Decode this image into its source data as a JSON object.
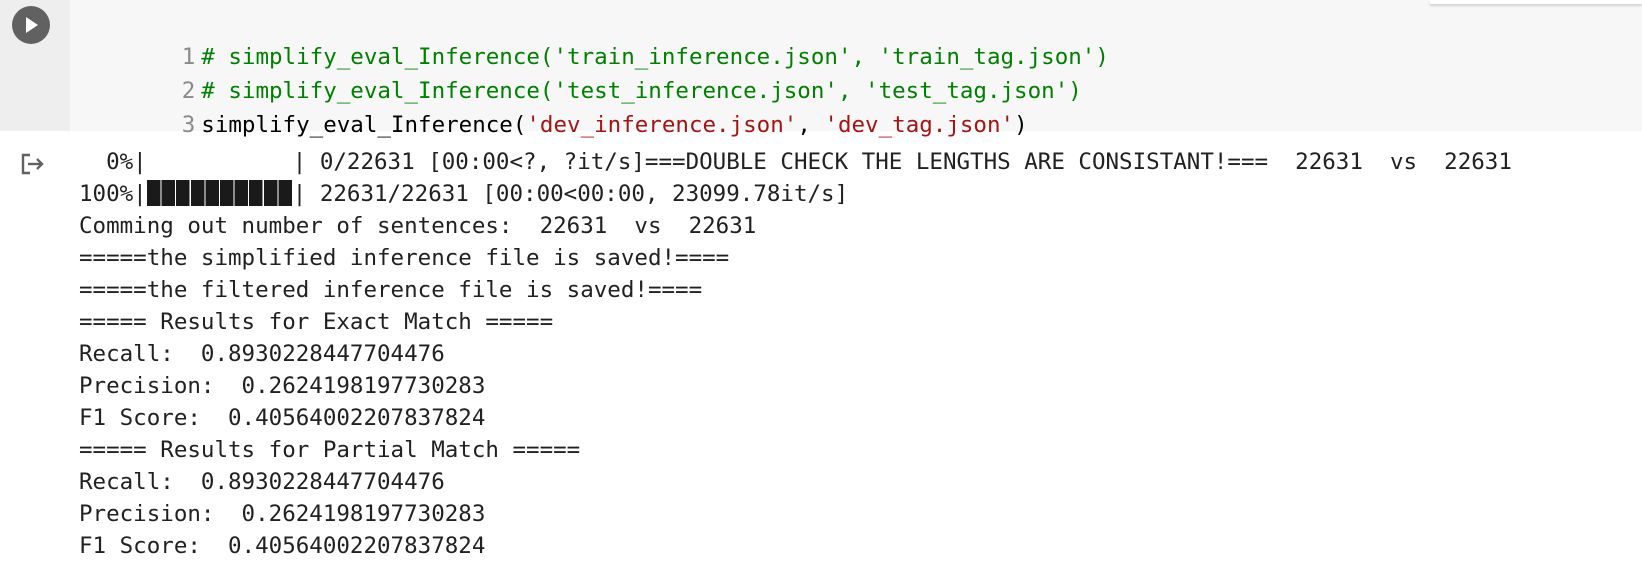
{
  "code_cell": {
    "lines": [
      {
        "number": "1",
        "text": "# simplify_eval_Inference('train_inference.json', 'train_tag.json')"
      },
      {
        "number": "2",
        "text": "# simplify_eval_Inference('test_inference.json', 'test_tag.json')"
      },
      {
        "number": "3",
        "func": "simplify_eval_Inference(",
        "arg1": "'dev_inference.json'",
        "sep": ", ",
        "arg2": "'dev_tag.json'",
        "close": ")"
      }
    ],
    "icons": {
      "run": "play-icon",
      "output": "output-redirect-icon"
    }
  },
  "output": {
    "progress_0": {
      "percent": "  0%|",
      "rest": "| 0/22631 [00:00<?, ?it/s]===DOUBLE CHECK THE LENGTHS ARE CONSISTANT!===  22631  vs  22631",
      "fill_fraction": 0
    },
    "progress_100": {
      "percent": "100%|",
      "rest": "| 22631/22631 [00:00<00:00, 23099.78it/s]",
      "fill_fraction": 1
    },
    "lines": [
      "Comming out number of sentences:  22631  vs  22631",
      "=====the simplified inference file is saved!====",
      "=====the filtered inference file is saved!====",
      "===== Results for Exact Match =====",
      "Recall:  0.8930228447704476",
      "Precision:  0.2624198197730283",
      "F1 Score:  0.40564002207837824",
      "===== Results for Partial Match =====",
      "Recall:  0.8930228447704476",
      "Precision:  0.2624198197730283",
      "F1 Score:  0.40564002207837824"
    ]
  },
  "colors": {
    "comment": "#008000",
    "string": "#a31515",
    "run_button": "#616161"
  }
}
